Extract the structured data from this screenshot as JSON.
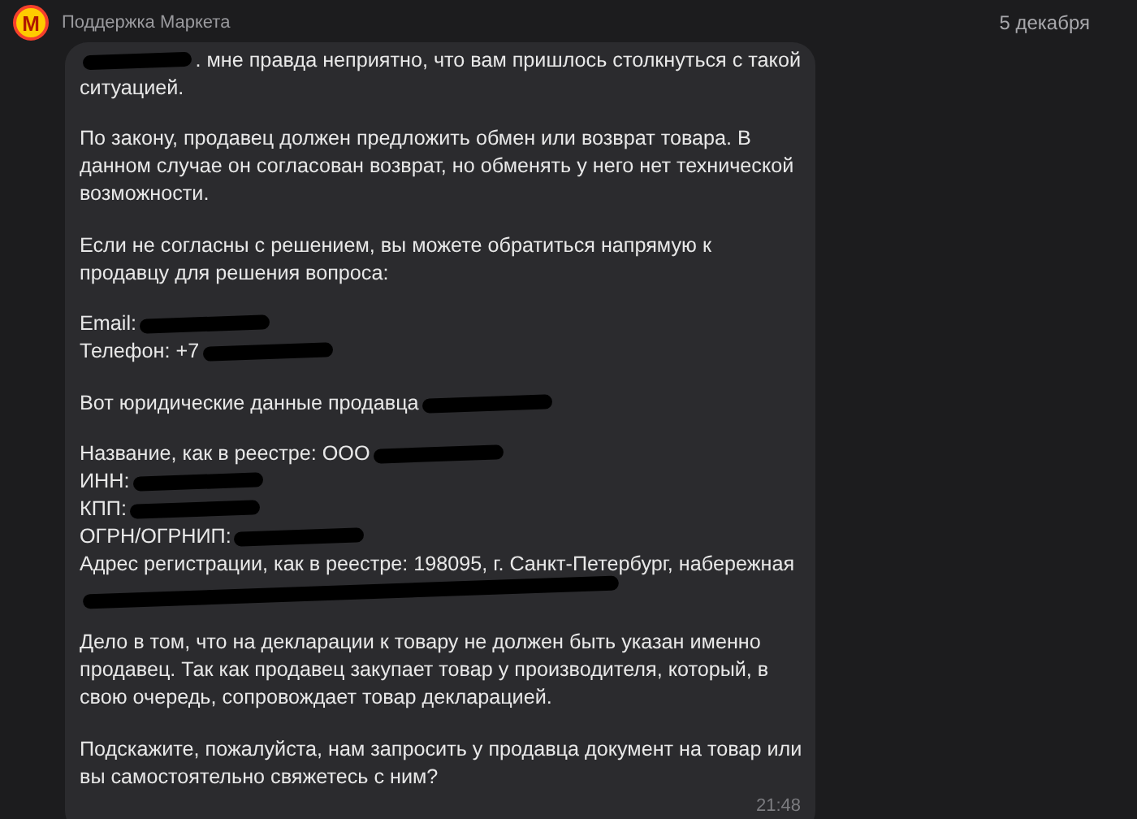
{
  "chat": {
    "avatar_letter": "M",
    "sender": "Поддержка Маркета",
    "date": "5 декабря"
  },
  "message": {
    "time": "21:48",
    "paragraphs": [
      {
        "lines": [
          {
            "text": ". мне правда неприятно, что вам пришлось столкнуться с такой",
            "mark_before": true
          },
          {
            "text": "ситуацией."
          }
        ]
      },
      {
        "lines": [
          {
            "text": "По закону, продавец должен предложить обмен или возврат товара. В"
          },
          {
            "text": "данном случае он согласован возврат, но обменять у него нет технической"
          },
          {
            "text": "возможности."
          }
        ]
      },
      {
        "lines": [
          {
            "text": "Если не согласны с решением, вы можете обратиться напрямую к"
          },
          {
            "text": "продавцу для решения вопроса:"
          }
        ]
      },
      {
        "lines": [
          {
            "text": "Email:",
            "mark_after": true
          },
          {
            "text": "Телефон: +7",
            "mark_after": true
          }
        ]
      },
      {
        "lines": [
          {
            "text": "Вот юридические данные продавца",
            "mark_after": true
          }
        ]
      },
      {
        "lines": [
          {
            "text": "Название, как в реестре: ООО",
            "mark_after": true
          },
          {
            "text": "ИНН:",
            "mark_after": true
          },
          {
            "text": "КПП:",
            "mark_after": true
          },
          {
            "text": "ОГРН/ОГРНИП:",
            "mark_after": true
          },
          {
            "text": "Адрес регистрации, как в реестре: 198095, г. Санкт-Петербург, набережная"
          },
          {
            "blacked_out": true
          }
        ]
      },
      {
        "lines": [
          {
            "text": "Дело в том, что на декларации к товару не должен быть указан именно"
          },
          {
            "text": "продавец. Так как продавец закупает товар у производителя, который, в"
          },
          {
            "text": "свою очередь, сопровождает товар декларацией."
          }
        ]
      },
      {
        "lines": [
          {
            "text": "Подскажите, пожалуйста, нам запросить у продавца документ на товар или"
          },
          {
            "text": "вы самостоятельно свяжетесь с ним?"
          }
        ]
      }
    ]
  }
}
